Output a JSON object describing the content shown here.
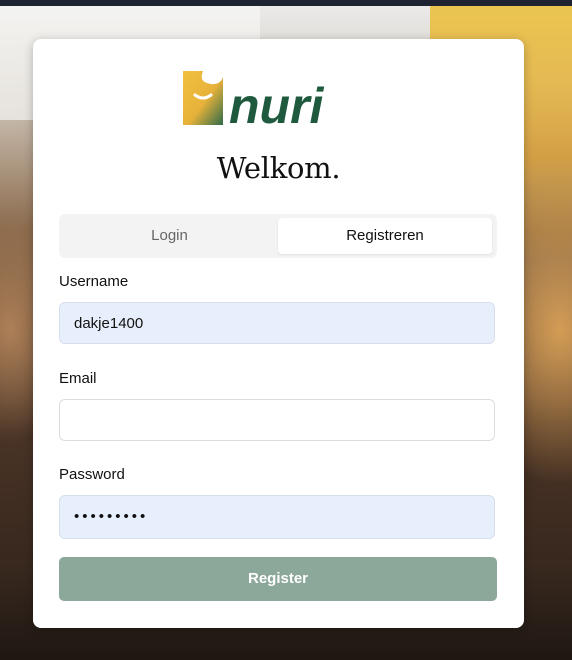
{
  "brand": {
    "name": "nuri",
    "color": "#1f5a3f",
    "accent": "#e8b23a"
  },
  "title": "Welkom.",
  "tabs": [
    {
      "label": "Login",
      "active": false
    },
    {
      "label": "Registreren",
      "active": true
    }
  ],
  "form": {
    "username_label": "Username",
    "username_value": "dakje1400",
    "email_label": "Email",
    "email_value": "",
    "password_label": "Password",
    "password_masked": "•••••••••",
    "submit_label": "Register"
  },
  "colors": {
    "button": "#8ca89b",
    "filled_field": "#e8effc"
  }
}
